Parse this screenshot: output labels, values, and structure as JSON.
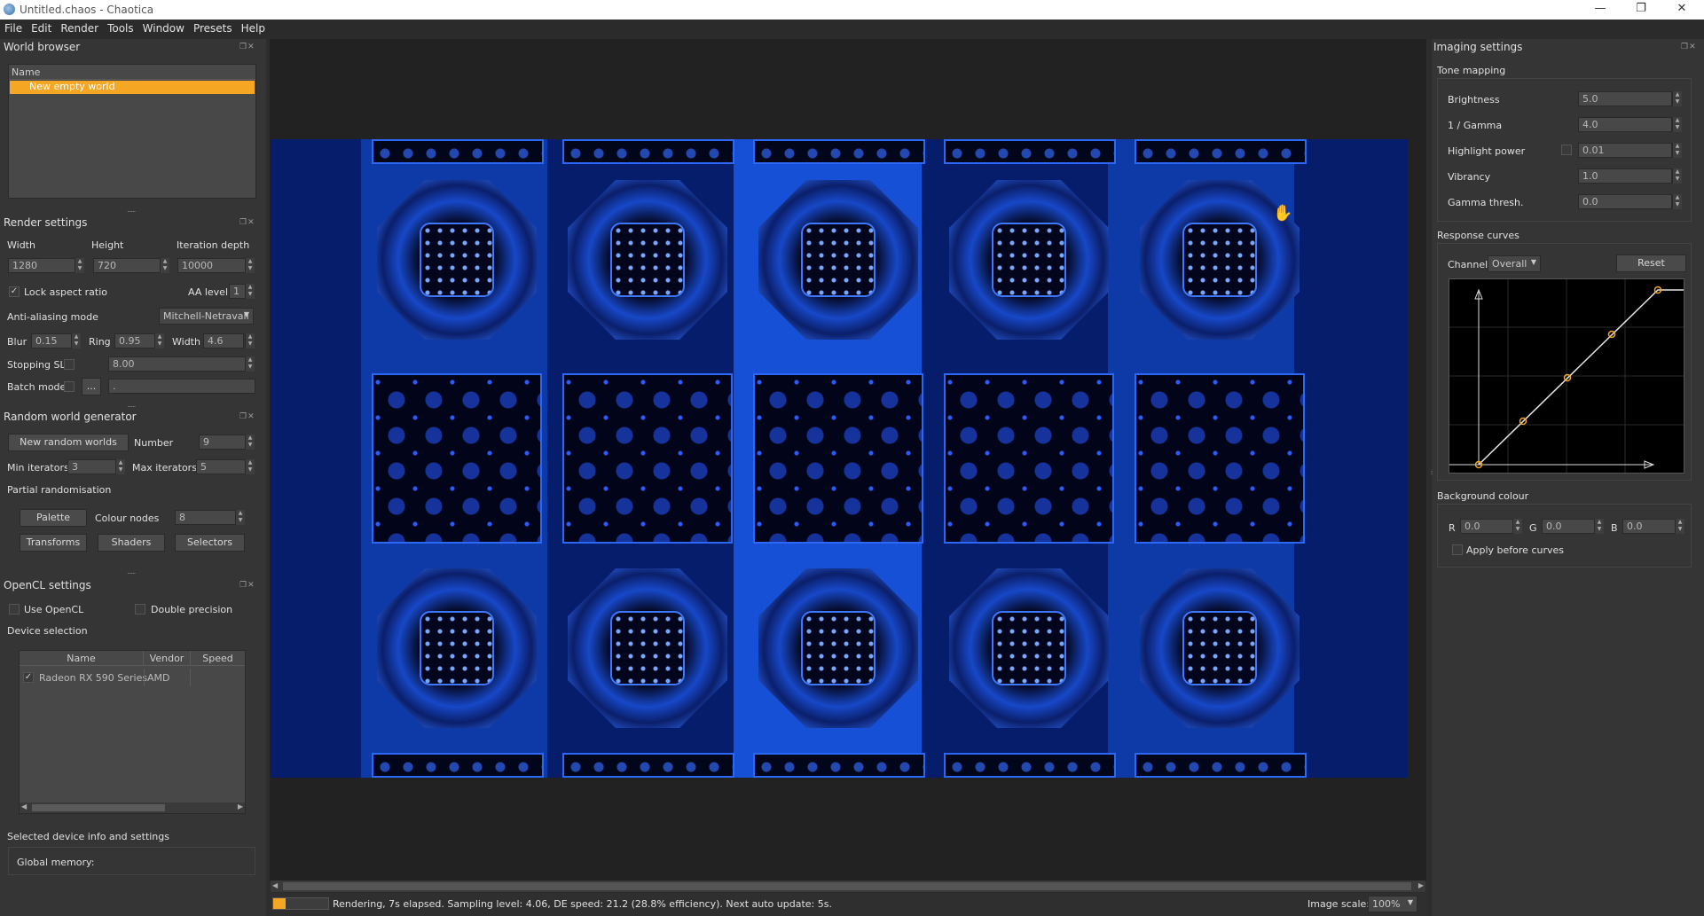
{
  "window": {
    "title": "Untitled.chaos - Chaotica",
    "minimize": "—",
    "restore": "❐",
    "close": "✕"
  },
  "menu": [
    "File",
    "Edit",
    "Render",
    "Tools",
    "Window",
    "Presets",
    "Help"
  ],
  "world_browser": {
    "title": "World browser",
    "column": "Name",
    "items": [
      "New empty world"
    ]
  },
  "render_settings": {
    "title": "Render settings",
    "width_label": "Width",
    "height_label": "Height",
    "iter_label": "Iteration depth",
    "width": "1280",
    "height": "720",
    "iter_depth": "10000",
    "lock_label": "Lock aspect ratio",
    "lock_checked": "✓",
    "aa_label": "AA level",
    "aa_level": "1",
    "aa_mode_label": "Anti-aliasing mode",
    "aa_mode": "Mitchell-Netravali",
    "blur_label": "Blur",
    "blur": "0.15",
    "ring_label": "Ring",
    "ring": "0.95",
    "fwidth_label": "Width",
    "fwidth": "4.6",
    "stop_label": "Stopping SL",
    "stop_value": "8.00",
    "batch_label": "Batch mode",
    "batch_btn": "...",
    "batch_value": "."
  },
  "random_world": {
    "title": "Random world generator",
    "new_btn": "New random worlds",
    "number_label": "Number",
    "number": "9",
    "min_label": "Min iterators",
    "min": "3",
    "max_label": "Max iterators",
    "max": "5",
    "partial_label": "Partial randomisation",
    "palette_btn": "Palette",
    "nodes_label": "Colour nodes",
    "nodes": "8",
    "transforms_btn": "Transforms",
    "shaders_btn": "Shaders",
    "selectors_btn": "Selectors"
  },
  "opencl": {
    "title": "OpenCL settings",
    "use_label": "Use OpenCL",
    "double_label": "Double precision",
    "device_label": "Device selection",
    "columns": [
      "Name",
      "Vendor",
      "Speed"
    ],
    "devices": [
      {
        "check": "✓",
        "name": "Radeon RX 590 Series",
        "vendor": "AMD",
        "speed": ""
      }
    ],
    "info_label": "Selected device info and settings",
    "memory_label": "Global memory:"
  },
  "status": {
    "text": "Rendering, 7s elapsed. Sampling level: 4.06, DE speed: 21.2 (28.8% efficiency). Next auto update: 5s.",
    "progress": 0.22,
    "scale_label": "Image scale:",
    "scale": "100%"
  },
  "imaging": {
    "title": "Imaging settings",
    "tone_label": "Tone mapping",
    "brightness_label": "Brightness",
    "brightness": "5.0",
    "gamma_label": "1 / Gamma",
    "gamma": "4.0",
    "highlight_label": "Highlight power",
    "highlight": "0.01",
    "vibrancy_label": "Vibrancy",
    "vibrancy": "1.0",
    "gthresh_label": "Gamma thresh.",
    "gthresh": "0.0",
    "curves_label": "Response curves",
    "channel_label": "Channel:",
    "channel": "Overall",
    "reset_btn": "Reset",
    "bg_label": "Background colour",
    "r_label": "R",
    "r": "0.0",
    "g_label": "G",
    "g": "0.0",
    "b_label": "B",
    "b": "0.0",
    "apply_label": "Apply before curves"
  },
  "colors": {
    "accent": "#f5a623",
    "render_blue": "#2b68f5",
    "panel": "#353535"
  }
}
